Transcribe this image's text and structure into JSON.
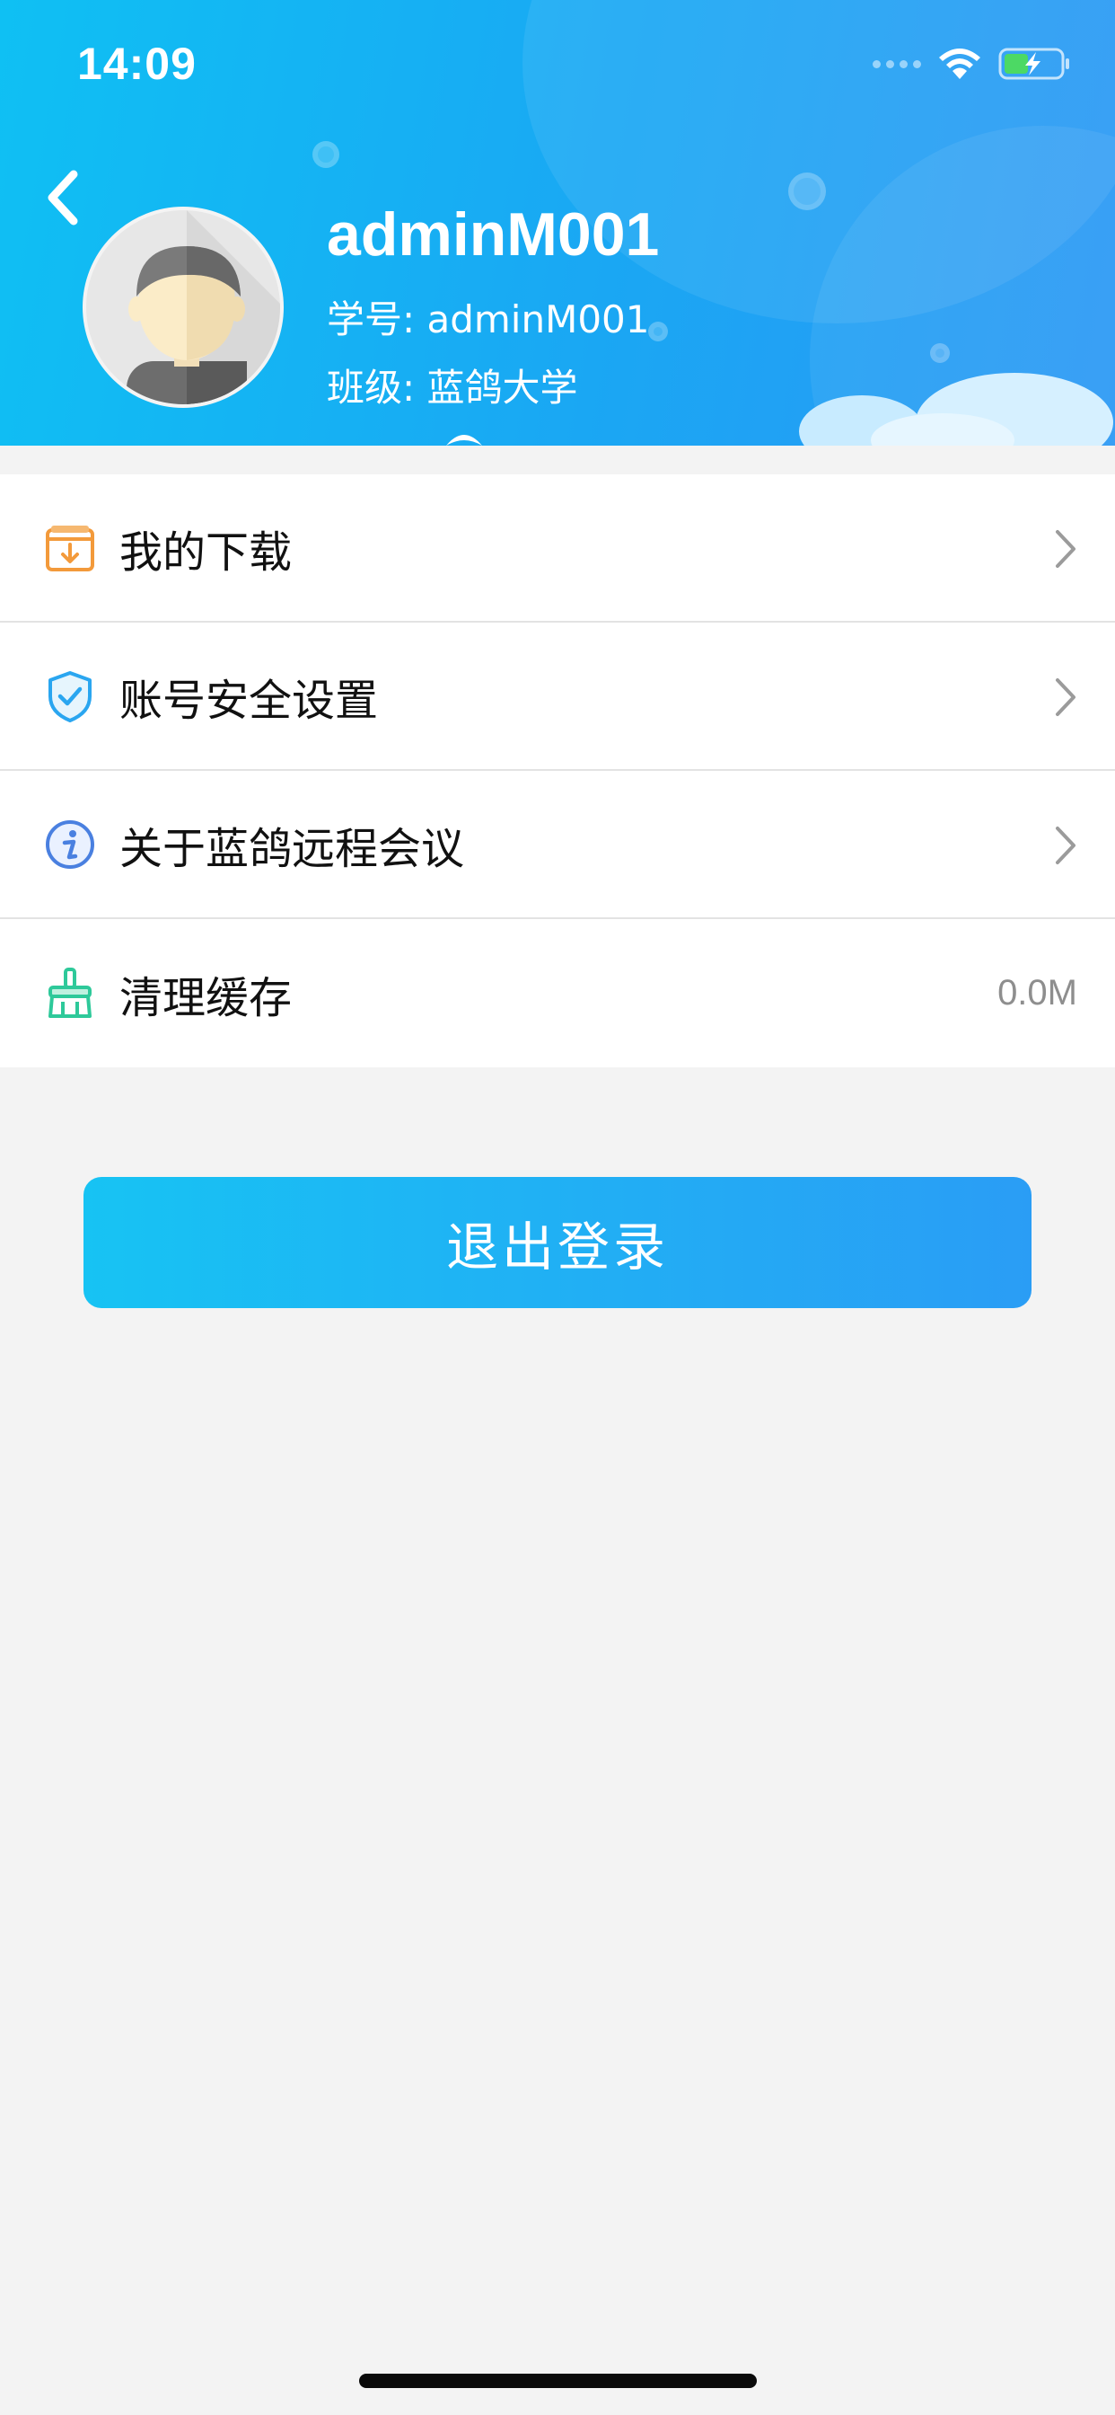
{
  "status_bar": {
    "time": "14:09",
    "icons": [
      "signal-icon",
      "wifi-icon",
      "battery-charging-icon"
    ]
  },
  "header": {
    "back_icon": "chevron-left-icon",
    "avatar_icon": "user-avatar-icon",
    "name": "adminM001",
    "student_id_line": "学号: adminM001",
    "class_line": "班级: 蓝鸽大学"
  },
  "menu": {
    "items": [
      {
        "icon": "download-folder-icon",
        "label": "我的下载",
        "trailing": "chevron-right-icon"
      },
      {
        "icon": "shield-check-icon",
        "label": "账号安全设置",
        "trailing": "chevron-right-icon"
      },
      {
        "icon": "info-icon",
        "label": "关于蓝鸽远程会议",
        "trailing": "chevron-right-icon"
      },
      {
        "icon": "broom-icon",
        "label": "清理缓存",
        "value": "0.0M"
      }
    ]
  },
  "logout_label": "退出登录",
  "colors": {
    "header_gradient_start": "#0fc0f3",
    "header_gradient_end": "#2b98f5",
    "button_gradient_start": "#17c3f3",
    "button_gradient_end": "#2a9df5",
    "page_background": "#f3f3f3",
    "download_icon": "#f39a3b",
    "shield_icon": "#2aa6f0",
    "info_icon": "#4a80e0",
    "broom_icon": "#2ec99a"
  }
}
